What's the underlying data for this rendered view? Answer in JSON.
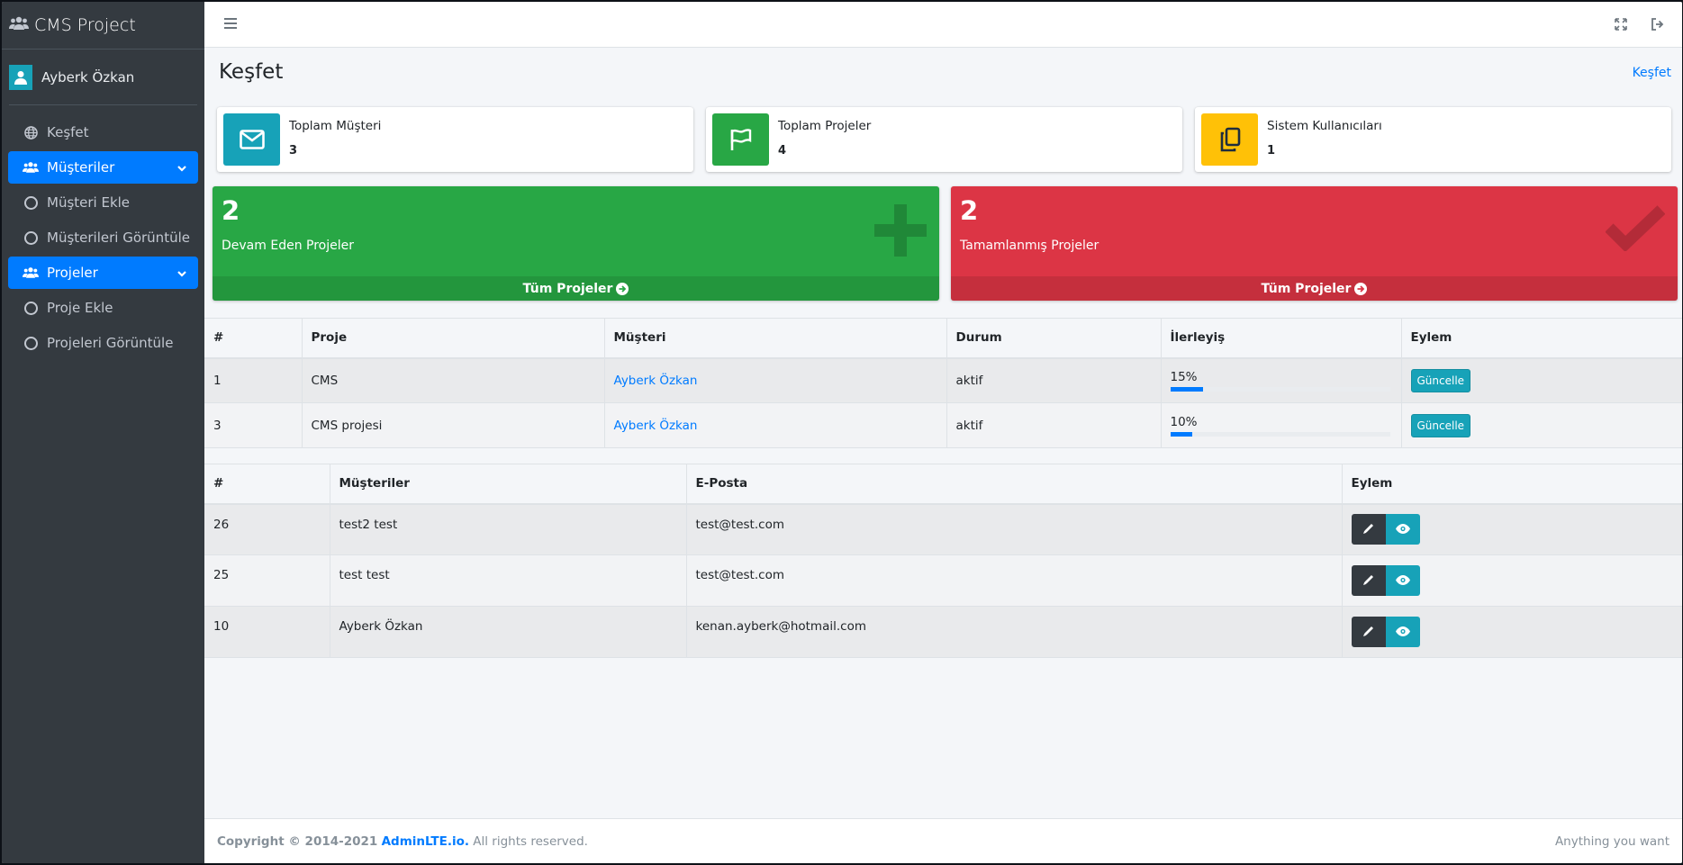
{
  "brand": {
    "title": "CMS Project"
  },
  "user": {
    "name": "Ayberk Özkan"
  },
  "sidebar": {
    "items": [
      {
        "label": "Keşfet",
        "icon": "globe-icon"
      },
      {
        "label": "Müşteriler",
        "icon": "users-icon",
        "active": true
      },
      {
        "label": "Müşteri Ekle",
        "icon": "circle-icon"
      },
      {
        "label": "Müşterileri Görüntüle",
        "icon": "circle-icon"
      },
      {
        "label": "Projeler",
        "icon": "users-icon",
        "active": true
      },
      {
        "label": "Proje Ekle",
        "icon": "circle-icon"
      },
      {
        "label": "Projeleri Görüntüle",
        "icon": "circle-icon"
      }
    ]
  },
  "header": {
    "title": "Keşfet",
    "breadcrumb": "Keşfet"
  },
  "info_boxes": [
    {
      "label": "Toplam Müşteri",
      "value": "3",
      "color": "#17a2b8",
      "icon": "envelope-icon"
    },
    {
      "label": "Toplam Projeler",
      "value": "4",
      "color": "#28a745",
      "icon": "flag-icon"
    },
    {
      "label": "Sistem Kullanıcıları",
      "value": "1",
      "color": "#ffc107",
      "icon": "copy-icon"
    }
  ],
  "small_boxes": [
    {
      "value": "2",
      "label": "Devam Eden Projeler",
      "link": "Tüm Projeler",
      "color": "#28a745",
      "icon": "plus-icon"
    },
    {
      "value": "2",
      "label": "Tamamlanmış Projeler",
      "link": "Tüm Projeler",
      "color": "#dc3545",
      "icon": "check-icon"
    }
  ],
  "projects_table": {
    "headers": [
      "#",
      "Proje",
      "Müşteri",
      "Durum",
      "İlerleyiş",
      "Eylem"
    ],
    "rows": [
      {
        "id": "1",
        "project": "CMS",
        "customer": "Ayberk Özkan",
        "status": "aktif",
        "progress_label": "15%",
        "progress": 0.15,
        "action": "Güncelle"
      },
      {
        "id": "3",
        "project": "CMS projesi",
        "customer": "Ayberk Özkan",
        "status": "aktif",
        "progress_label": "10%",
        "progress": 0.1,
        "action": "Güncelle"
      }
    ]
  },
  "customers_table": {
    "headers": [
      "#",
      "Müşteriler",
      "E-Posta",
      "Eylem"
    ],
    "rows": [
      {
        "id": "26",
        "name": "test2 test",
        "email": "test@test.com"
      },
      {
        "id": "25",
        "name": "test test",
        "email": "test@test.com"
      },
      {
        "id": "10",
        "name": "Ayberk Özkan",
        "email": "kenan.ayberk@hotmail.com"
      }
    ]
  },
  "footer": {
    "copyright": "Copyright © 2014-2021",
    "link": "AdminLTE.io.",
    "rights": "All rights reserved.",
    "right_text": "Anything you want"
  },
  "colors": {
    "primary": "#007bff",
    "sidebar": "#343a40",
    "info": "#17a2b8",
    "success": "#28a745",
    "danger": "#dc3545",
    "warning": "#ffc107"
  }
}
